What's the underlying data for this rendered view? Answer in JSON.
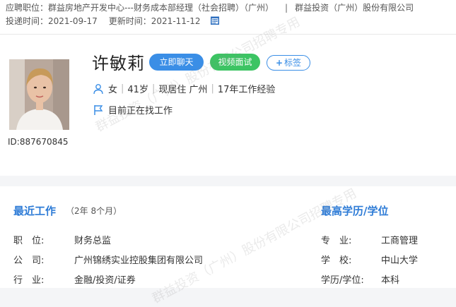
{
  "application": {
    "position_label": "应聘职位：",
    "position_value": "群益房地产开发中心---财务成本部经理（社会招聘）（广州）",
    "separator": "|",
    "company": "群益投资（广州）股份有限公司",
    "submit_label": "投递时间：",
    "submit_value": "2021-09-17",
    "update_label": "更新时间：",
    "update_value": "2021-11-12"
  },
  "profile": {
    "name": "许敏莉",
    "id_text": "ID:887670845",
    "buttons": {
      "chat": "立即聊天",
      "video": "视频面试",
      "tag_plus": "+",
      "tag": "标签"
    },
    "gender": "女",
    "age": "41岁",
    "residence": "现居住 广州",
    "experience": "17年工作经验",
    "divider": "|",
    "status": "目前正在找工作",
    "accent_color": "#3a8ee6",
    "video_color": "#3cc463"
  },
  "watermark": {
    "text_a": "群益投资（广州）股份有限公司招聘专用",
    "text_b": "群益投资（广州）股份有限公司招聘专用"
  },
  "recent_work": {
    "title": "最近工作",
    "duration": "（2年 8个月）",
    "rows": [
      {
        "key": "职　位:",
        "value": "财务总监"
      },
      {
        "key": "公　司:",
        "value": "广州锦绣实业控股集团有限公司"
      },
      {
        "key": "行　业:",
        "value": "金融/投资/证券"
      }
    ]
  },
  "education": {
    "title": "最高学历/学位",
    "rows": [
      {
        "key": "专　业:",
        "value": "工商管理"
      },
      {
        "key": "学　校:",
        "value": "中山大学"
      },
      {
        "key": "学历/学位:",
        "value": "本科"
      }
    ]
  }
}
